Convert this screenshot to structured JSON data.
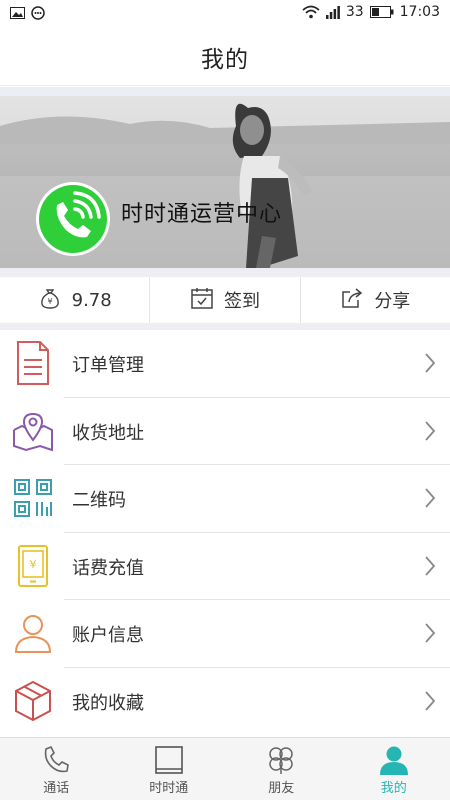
{
  "status_bar": {
    "signal_text": "33",
    "time": "17:03"
  },
  "header": {
    "title": "我的"
  },
  "profile": {
    "name": "时时通运营中心"
  },
  "stats": {
    "balance": "9.78",
    "checkin_label": "签到",
    "share_label": "分享"
  },
  "menu": {
    "items": [
      {
        "label": "订单管理",
        "icon": "order-document-icon"
      },
      {
        "label": "收货地址",
        "icon": "map-location-icon"
      },
      {
        "label": "二维码",
        "icon": "qr-code-icon"
      },
      {
        "label": "话费充值",
        "icon": "phone-recharge-icon"
      },
      {
        "label": "账户信息",
        "icon": "user-account-icon"
      },
      {
        "label": "我的收藏",
        "icon": "favorite-box-icon"
      }
    ]
  },
  "bottom_nav": {
    "items": [
      {
        "label": "通话",
        "icon": "phone-icon"
      },
      {
        "label": "时时通",
        "icon": "square-app-icon"
      },
      {
        "label": "朋友",
        "icon": "clover-icon"
      },
      {
        "label": "我的",
        "icon": "person-icon"
      }
    ],
    "active_index": 3,
    "active_color": "#25b6b3"
  },
  "colors": {
    "brand_green": "#2fcf3a",
    "accent_teal": "#25b6b3",
    "band_gray": "#eceef3"
  }
}
